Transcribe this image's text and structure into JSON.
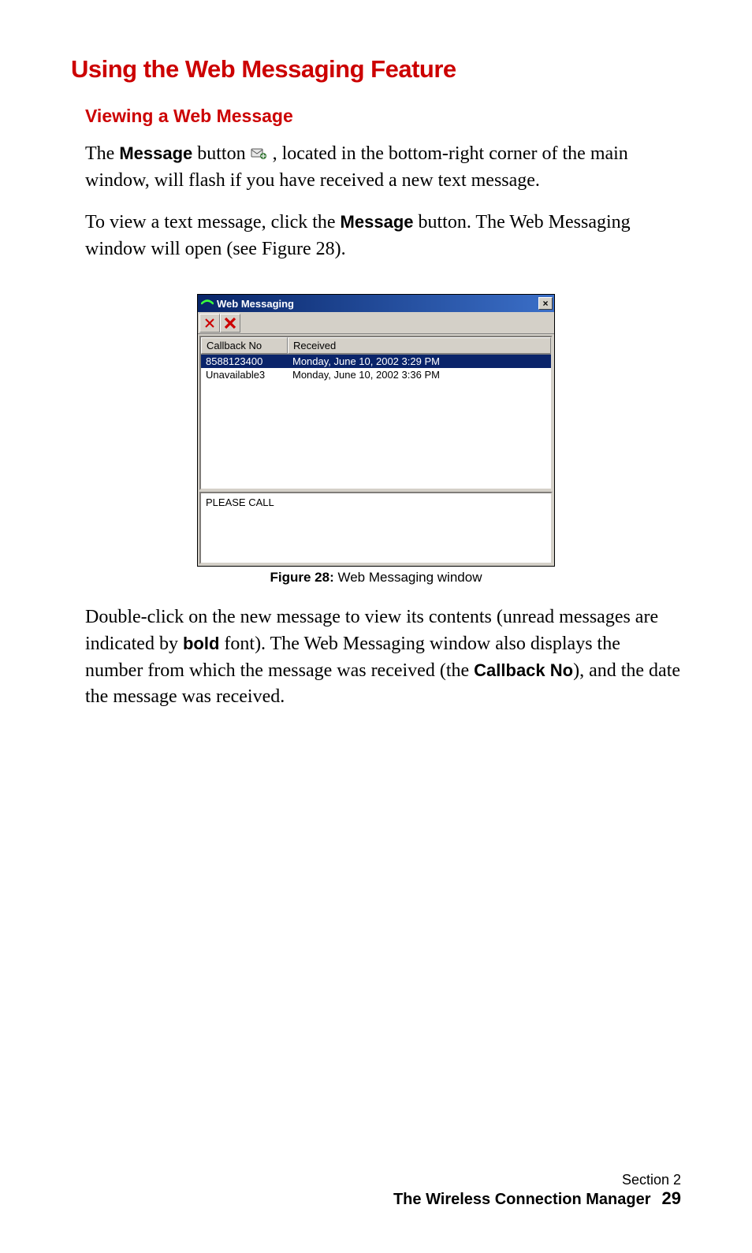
{
  "heading": "Using the Web Messaging Feature",
  "subheading": "Viewing a Web Message",
  "para1": {
    "t1": "The ",
    "bold1": "Message",
    "t2": " button  ",
    "t3": " , located in the bottom-right corner of the main window, will flash if you have received a new text message."
  },
  "para2": {
    "t1": "To view a text message, click the ",
    "bold1": "Message",
    "t2": " button. The Web Messaging window will open (see Figure 28)."
  },
  "window": {
    "title": "Web Messaging",
    "close_glyph": "×",
    "columns": {
      "callback": "Callback No",
      "received": "Received"
    },
    "rows": [
      {
        "callback": "8588123400",
        "received": "Monday, June 10, 2002 3:29 PM",
        "selected": true
      },
      {
        "callback": "Unavailable3",
        "received": "Monday, June 10, 2002 3:36 PM",
        "selected": false
      }
    ],
    "preview": "PLEASE CALL"
  },
  "figure": {
    "label": "Figure 28:",
    "caption": " Web Messaging window"
  },
  "para3": {
    "t1": "Double-click on the new message to view its contents (unread messages are indicated by ",
    "bold1": "bold",
    "t2": " font). The Web Messaging window also displays the number from which the message was received (the ",
    "bold2": "Callback No",
    "t3": "), and the date the message was received."
  },
  "footer": {
    "section": "Section 2",
    "title": "The Wireless Connection Manager",
    "page": "29"
  }
}
